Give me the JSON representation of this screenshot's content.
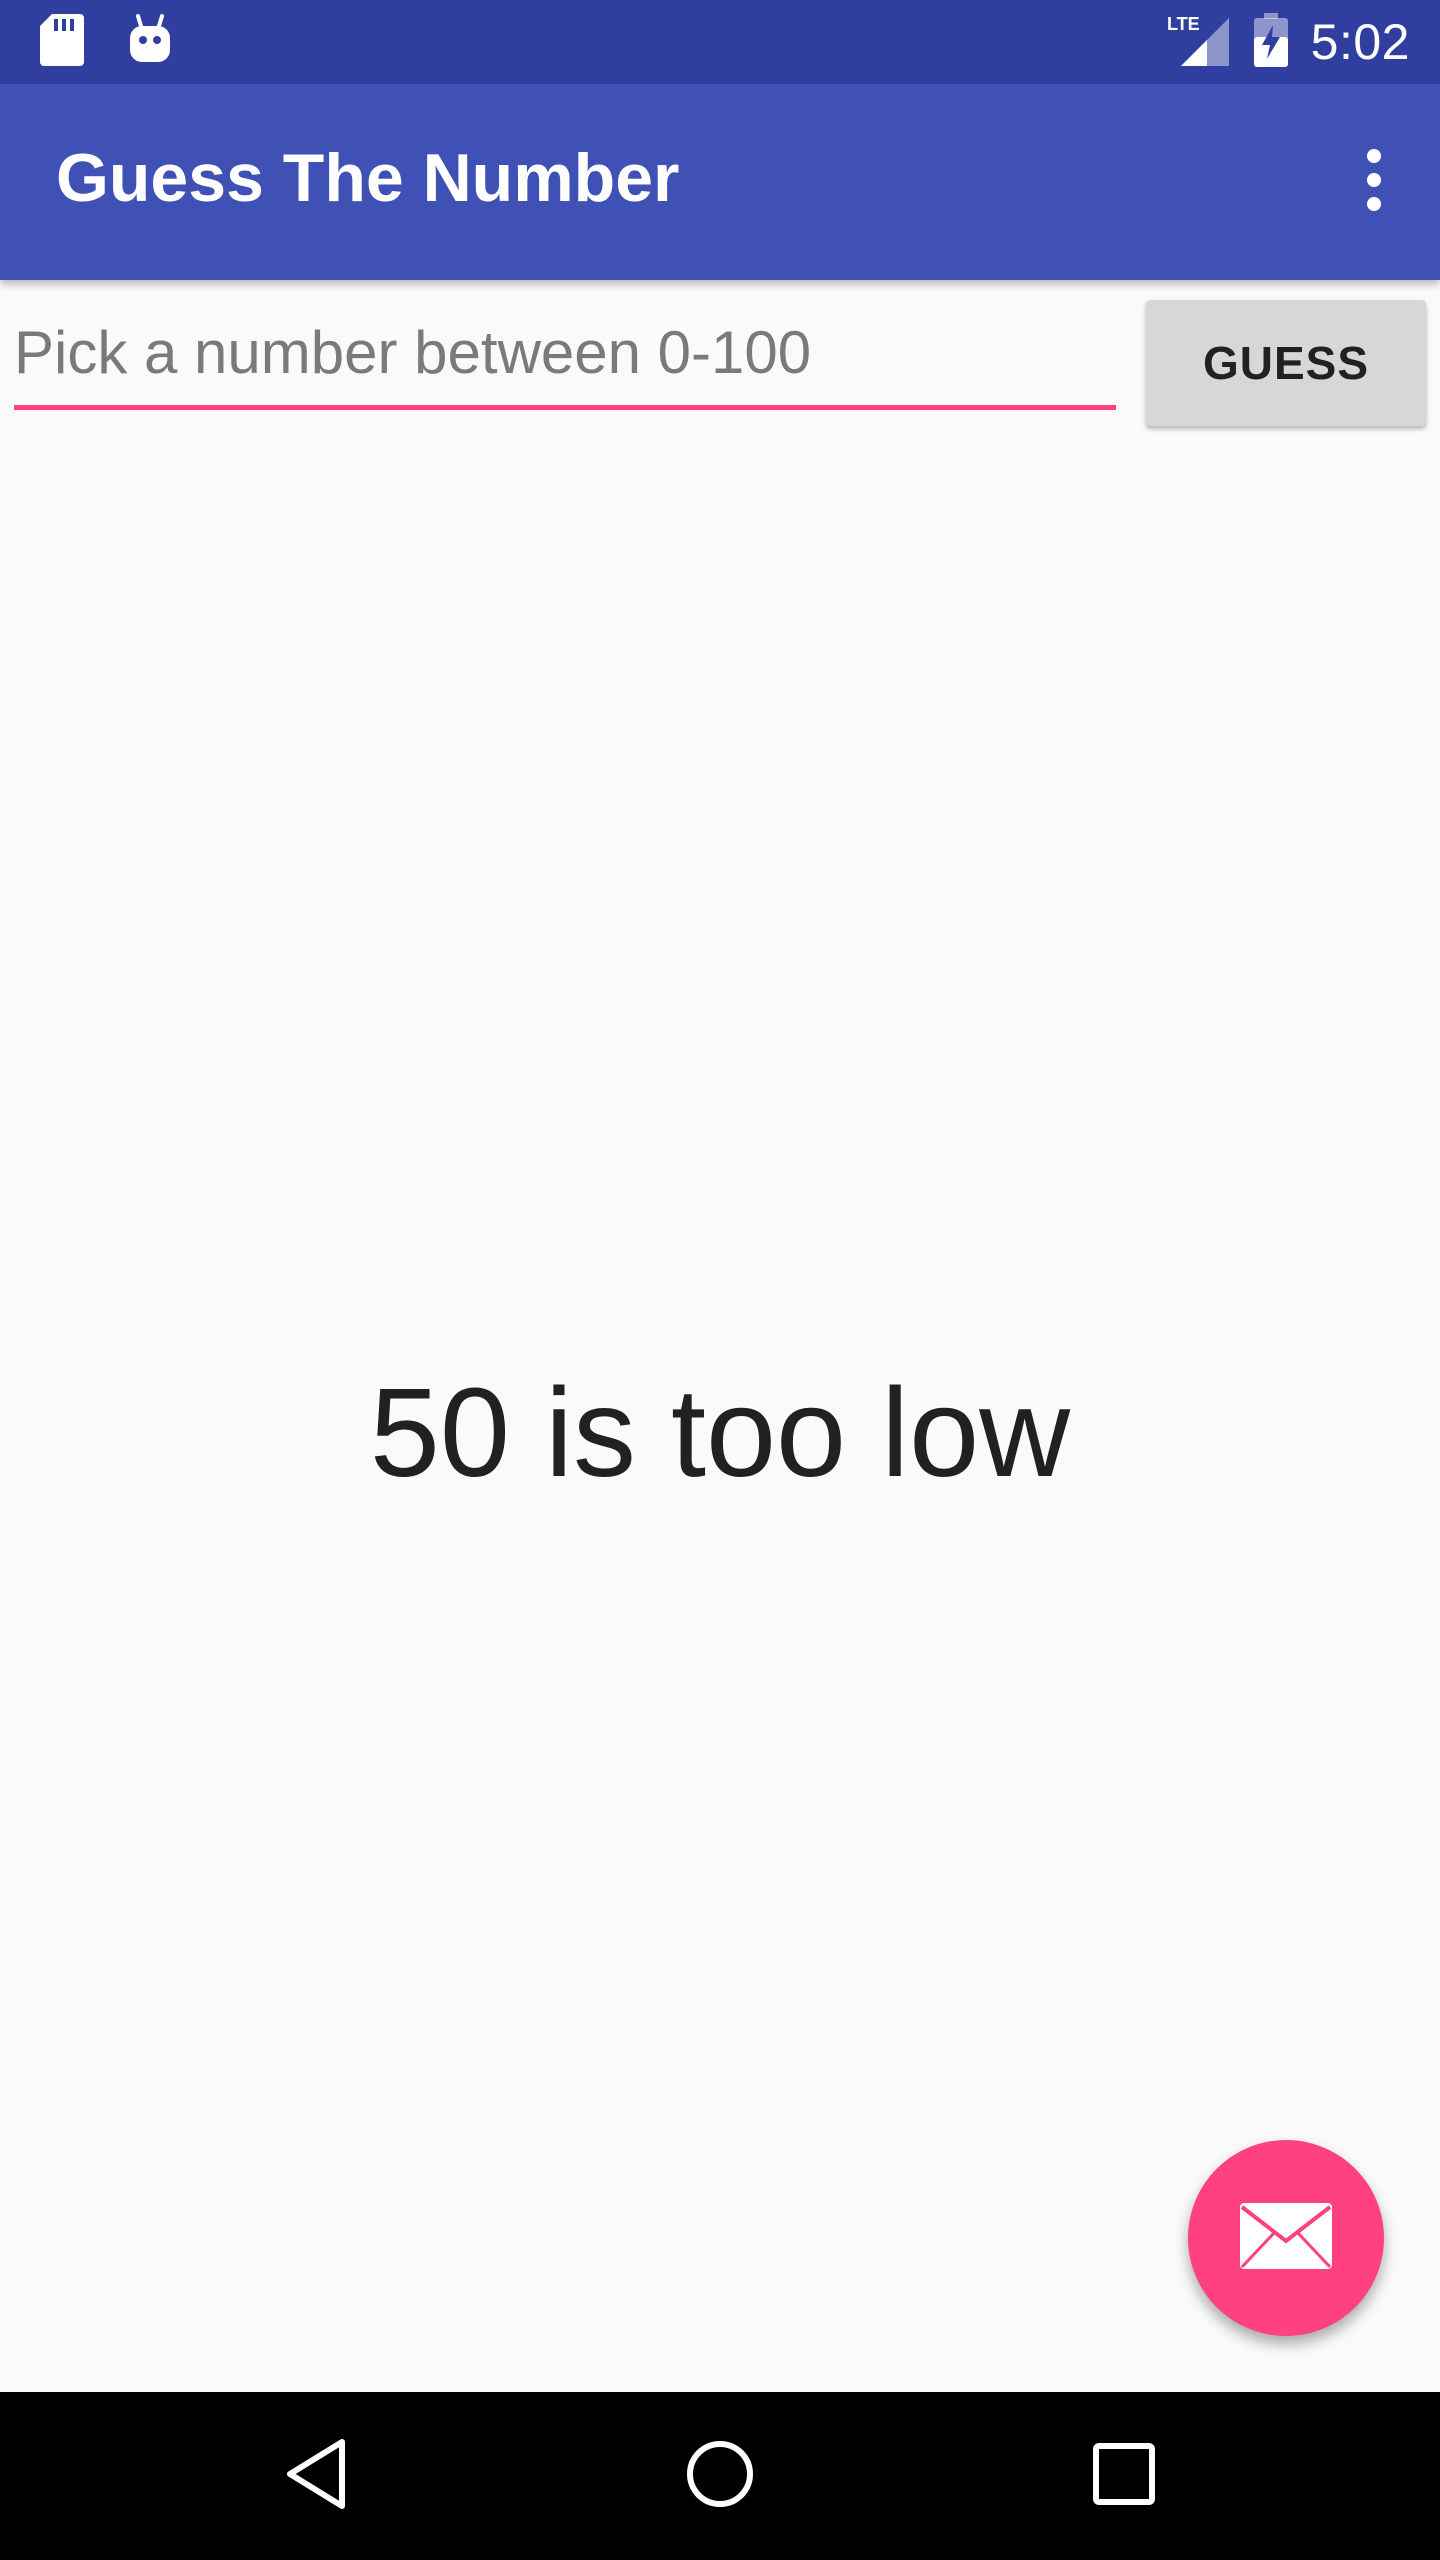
{
  "status_bar": {
    "time": "5:02",
    "network_label": "LTE",
    "icons": [
      "sd-card-icon",
      "android-icon",
      "signal-icon",
      "battery-charging-icon"
    ]
  },
  "app_bar": {
    "title": "Guess The Number",
    "menu_icon": "more-vert-icon"
  },
  "guess_form": {
    "input_value": "",
    "input_placeholder": "Pick a number between 0-100",
    "button_label": "GUESS"
  },
  "result": {
    "message": "50 is too low"
  },
  "fab": {
    "icon": "email-icon"
  },
  "nav_bar": {
    "icons": [
      "back-icon",
      "home-icon",
      "recents-icon"
    ]
  },
  "colors": {
    "status_bar": "#303f9f",
    "app_bar": "#3f51b5",
    "accent": "#ff4081",
    "background": "#fafafa",
    "button": "#d6d7d7"
  }
}
